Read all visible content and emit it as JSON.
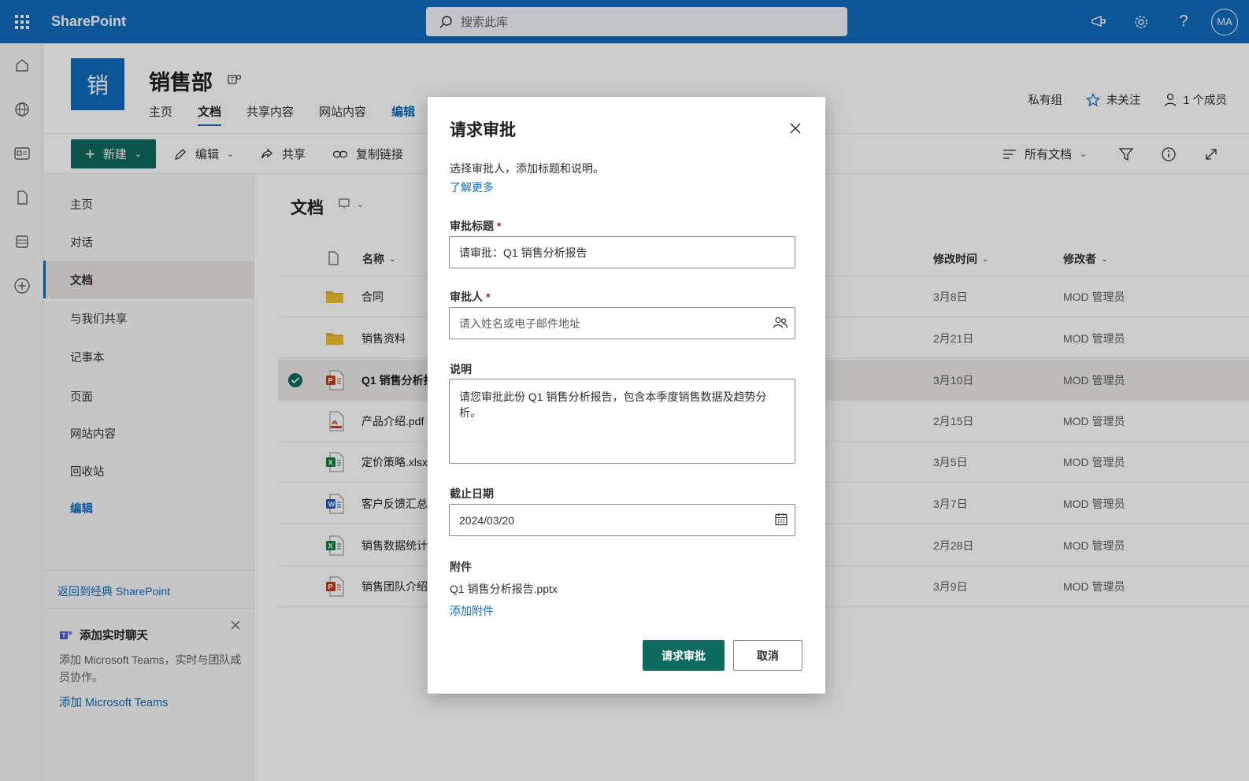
{
  "suite": {
    "brand": "SharePoint",
    "search_placeholder": "搜索此库",
    "avatar_initials": "MA"
  },
  "site": {
    "logo_char": "销",
    "title": "销售部",
    "nav": [
      "主页",
      "文档",
      "共享内容",
      "网站内容",
      "编辑"
    ],
    "privacy": "私有组",
    "follow": "未关注",
    "members": "1 个成员"
  },
  "commands": {
    "new": "新建",
    "edit": "编辑",
    "share": "共享",
    "copy_link": "复制链接",
    "view": "所有文档"
  },
  "leftnav": {
    "items": [
      "主页",
      "对话",
      "文档",
      "与我们共享",
      "记事本",
      "页面",
      "网站内容",
      "回收站",
      "编辑"
    ],
    "active_index": 2,
    "classic_link": "返回到经典 SharePoint",
    "teams_title": "添加实时聊天",
    "teams_desc": "添加 Microsoft Teams，实时与团队成员协作。",
    "teams_add": "添加 Microsoft Teams"
  },
  "library": {
    "title": "文档",
    "columns": {
      "name": "名称",
      "modified": "修改时间",
      "modified_by": "修改者"
    },
    "rows": [
      {
        "name": "合同",
        "type": "folder",
        "modified": "3月8日",
        "modified_by": "MOD 管理员"
      },
      {
        "name": "销售资料",
        "type": "folder",
        "modified": "2月21日",
        "modified_by": "MOD 管理员"
      },
      {
        "name": "Q1 销售分析报",
        "type": "pptx",
        "modified": "3月10日",
        "modified_by": "MOD 管理员",
        "selected": true
      },
      {
        "name": "产品介绍.pdf",
        "type": "pdf",
        "modified": "2月15日",
        "modified_by": "MOD 管理员"
      },
      {
        "name": "定价策略.xlsx",
        "type": "xlsx",
        "modified": "3月5日",
        "modified_by": "MOD 管理员"
      },
      {
        "name": "客户反馈汇总",
        "type": "docx",
        "modified": "3月7日",
        "modified_by": "MOD 管理员"
      },
      {
        "name": "销售数据统计",
        "type": "xlsx",
        "modified": "2月28日",
        "modified_by": "MOD 管理员"
      },
      {
        "name": "销售团队介绍",
        "type": "pptx",
        "modified": "3月9日",
        "modified_by": "MOD 管理员"
      }
    ]
  },
  "dialog": {
    "title": "请求审批",
    "subtitle": "选择审批人，添加标题和说明。",
    "learn_more": "了解更多",
    "title_label": "审批标题",
    "title_value": "请审批：Q1 销售分析报告",
    "approver_label": "审批人",
    "approver_placeholder": "请入姓名或电子邮件地址",
    "desc_label": "说明",
    "desc_value": "请您审批此份 Q1 销售分析报告，包含本季度销售数据及趋势分析。",
    "due_label": "截止日期",
    "due_value": "2024/03/20",
    "attach_label": "附件",
    "attach_name": "Q1 销售分析报告.pptx",
    "attach_add": "添加附件",
    "submit": "请求审批",
    "cancel": "取消",
    "required_mark": "*"
  },
  "colors": {
    "brand": "#0f6cbd",
    "primary_button": "#0e6b5e",
    "folder": "#dcb12b",
    "word": "#185abd",
    "excel": "#107c41",
    "ppt": "#c43e1c",
    "pdf": "#d13438"
  }
}
